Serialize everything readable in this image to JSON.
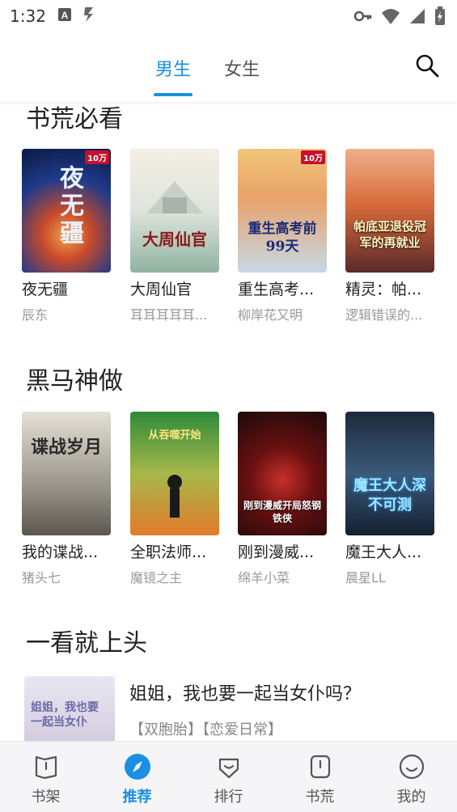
{
  "status": {
    "time": "1:32"
  },
  "tabs": {
    "male": "男生",
    "female": "女生"
  },
  "sections": {
    "s1": {
      "title": "书荒必看",
      "books": [
        {
          "title": "夜无疆",
          "author": "辰东",
          "cover_text": "夜无疆"
        },
        {
          "title": "大周仙官",
          "author": "耳耳耳耳耳...",
          "cover_text": "大周仙官"
        },
        {
          "title": "重生高考...",
          "author": "柳岸花又明",
          "cover_text": "重生高考前99天"
        },
        {
          "title": "精灵：帕...",
          "author": "逻辑错误的...",
          "cover_text": "帕底亚退役冠军的再就业"
        }
      ]
    },
    "s2": {
      "title": "黑马神做",
      "books": [
        {
          "title": "我的谍战...",
          "author": "猪头七",
          "cover_text": "谍战岁月"
        },
        {
          "title": "全职法师...",
          "author": "魔镜之主",
          "cover_text": "从吞噬开始"
        },
        {
          "title": "刚到漫威...",
          "author": "绵羊小菜",
          "cover_text": "刚到漫威开局怒钢铁侠"
        },
        {
          "title": "魔王大人...",
          "author": "晨星LL",
          "cover_text": "魔王大人深不可测"
        }
      ]
    },
    "s3": {
      "title": "一看就上头",
      "item": {
        "title": "姐姐，我也要一起当女仆吗？",
        "tags": "【双胞胎】【恋爱日常】",
        "cover_text": "姐姐，我也要一起当女仆"
      }
    }
  },
  "badges": {
    "wan": "10万"
  },
  "bottom_nav": [
    {
      "label": "书架"
    },
    {
      "label": "推荐"
    },
    {
      "label": "排行"
    },
    {
      "label": "书荒"
    },
    {
      "label": "我的"
    }
  ],
  "colors": {
    "accent": "#1a8fe3"
  }
}
